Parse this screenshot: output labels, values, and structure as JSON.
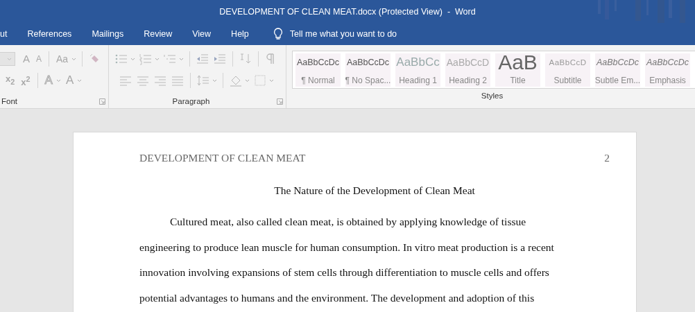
{
  "window": {
    "title": "DEVELOPMENT OF CLEAN MEAT.docx (Protected View)  -  Word"
  },
  "tabs": [
    {
      "label": "ut",
      "selected": false
    },
    {
      "label": "References",
      "selected": false
    },
    {
      "label": "Mailings",
      "selected": false
    },
    {
      "label": "Review",
      "selected": false
    },
    {
      "label": "View",
      "selected": false
    },
    {
      "label": "Help",
      "selected": false
    }
  ],
  "tell_me": {
    "placeholder": "Tell me what you want to do"
  },
  "ribbon": {
    "disabled": true,
    "font_tools": [
      {
        "glyph": "A",
        "kind": "grow"
      },
      {
        "glyph": "A",
        "kind": "shrink"
      },
      {
        "glyph": "Aa",
        "kind": "case"
      },
      {
        "glyph": "x$_{2}$",
        "kind": "sub"
      },
      {
        "glyph": "x$^{2}$",
        "kind": "sup"
      },
      {
        "glyph": "A",
        "kind": "effects"
      },
      {
        "glyph": "A",
        "kind": "color"
      }
    ],
    "groups": [
      {
        "label": "Font"
      },
      {
        "label": "Paragraph"
      },
      {
        "label": "Styles"
      }
    ],
    "styles": [
      {
        "sample": "AaBbCcDc",
        "name": "¶ Normal",
        "kind": "normal"
      },
      {
        "sample": "AaBbCcDc",
        "name": "¶ No Spac...",
        "kind": "normal"
      },
      {
        "sample": "AaBbCc",
        "name": "Heading 1",
        "kind": "heading1"
      },
      {
        "sample": "AaBbCcD",
        "name": "Heading 2",
        "kind": "heading2"
      },
      {
        "sample": "AaB",
        "name": "Title",
        "kind": "title"
      },
      {
        "sample": "AaBbCcD",
        "name": "Subtitle",
        "kind": "subtitle"
      },
      {
        "sample": "AaBbCcDc",
        "name": "Subtle Em...",
        "kind": "emphasis"
      },
      {
        "sample": "AaBbCcDc",
        "name": "Emphasis",
        "kind": "emphasis"
      }
    ]
  },
  "document": {
    "header": "DEVELOPMENT OF CLEAN MEAT",
    "page_number": "2",
    "title": "The Nature of the Development of Clean Meat",
    "paragraph": [
      "Cultured meat, also called clean meat, is obtained by applying knowledge of tissue",
      "engineering to produce lean muscle for human consumption. In vitro meat production is a recent",
      "innovation involving expansions of stem cells through differentiation to muscle cells and offers",
      "potential advantages to humans and the environment. The development and adoption of this"
    ]
  }
}
